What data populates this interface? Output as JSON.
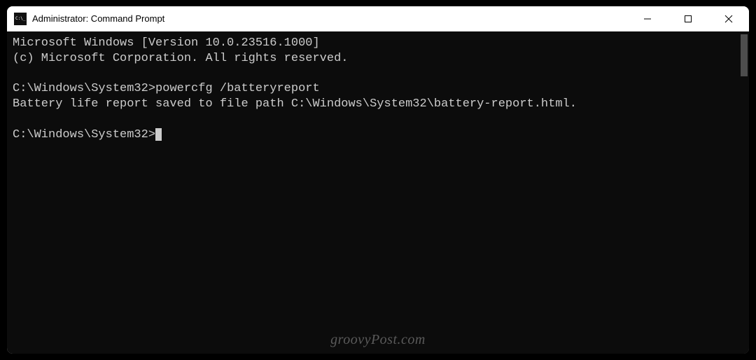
{
  "titlebar": {
    "title": "Administrator: Command Prompt"
  },
  "terminal": {
    "line1": "Microsoft Windows [Version 10.0.23516.1000]",
    "line2": "(c) Microsoft Corporation. All rights reserved.",
    "blank1": "",
    "prompt1_path": "C:\\Windows\\System32>",
    "prompt1_cmd": "powercfg /batteryreport",
    "output1": "Battery life report saved to file path C:\\Windows\\System32\\battery-report.html.",
    "blank2": "",
    "prompt2_path": "C:\\Windows\\System32>"
  },
  "watermark": "groovyPost.com"
}
